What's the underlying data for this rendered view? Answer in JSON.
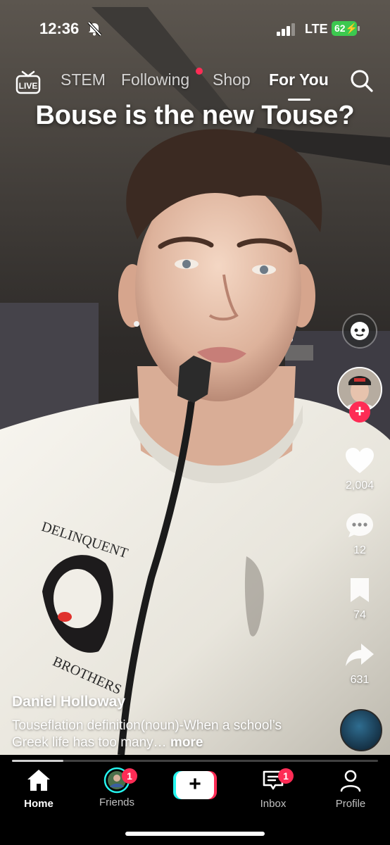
{
  "status_bar": {
    "time": "12:36",
    "network": "LTE",
    "battery": "62"
  },
  "top_nav": {
    "live_label": "LIVE",
    "tabs": [
      {
        "label": "STEM"
      },
      {
        "label": "Following"
      },
      {
        "label": "Shop"
      },
      {
        "label": "For You"
      }
    ],
    "active_tab": "For You"
  },
  "video": {
    "overlay_title": "Bouse is the new Touse?",
    "author": "Daniel Holloway",
    "description": "Touseflation definition(noun)-When a school’s Greek life has too many…",
    "more_label": " more",
    "shirt_print_text": [
      "DELINQUENT",
      "BROTHERS"
    ]
  },
  "actions": {
    "likes": "2,004",
    "comments": "12",
    "saves": "74",
    "shares": "631"
  },
  "progress": {
    "fraction": 0.14
  },
  "bottom_nav": {
    "items": [
      {
        "label": "Home"
      },
      {
        "label": "Friends",
        "badge": "1"
      },
      {
        "label": "Inbox",
        "badge": "1"
      },
      {
        "label": "Profile"
      }
    ]
  },
  "colors": {
    "accent_red": "#fe2c55",
    "accent_cyan": "#25f4ee",
    "battery_green": "#3cc84f"
  }
}
